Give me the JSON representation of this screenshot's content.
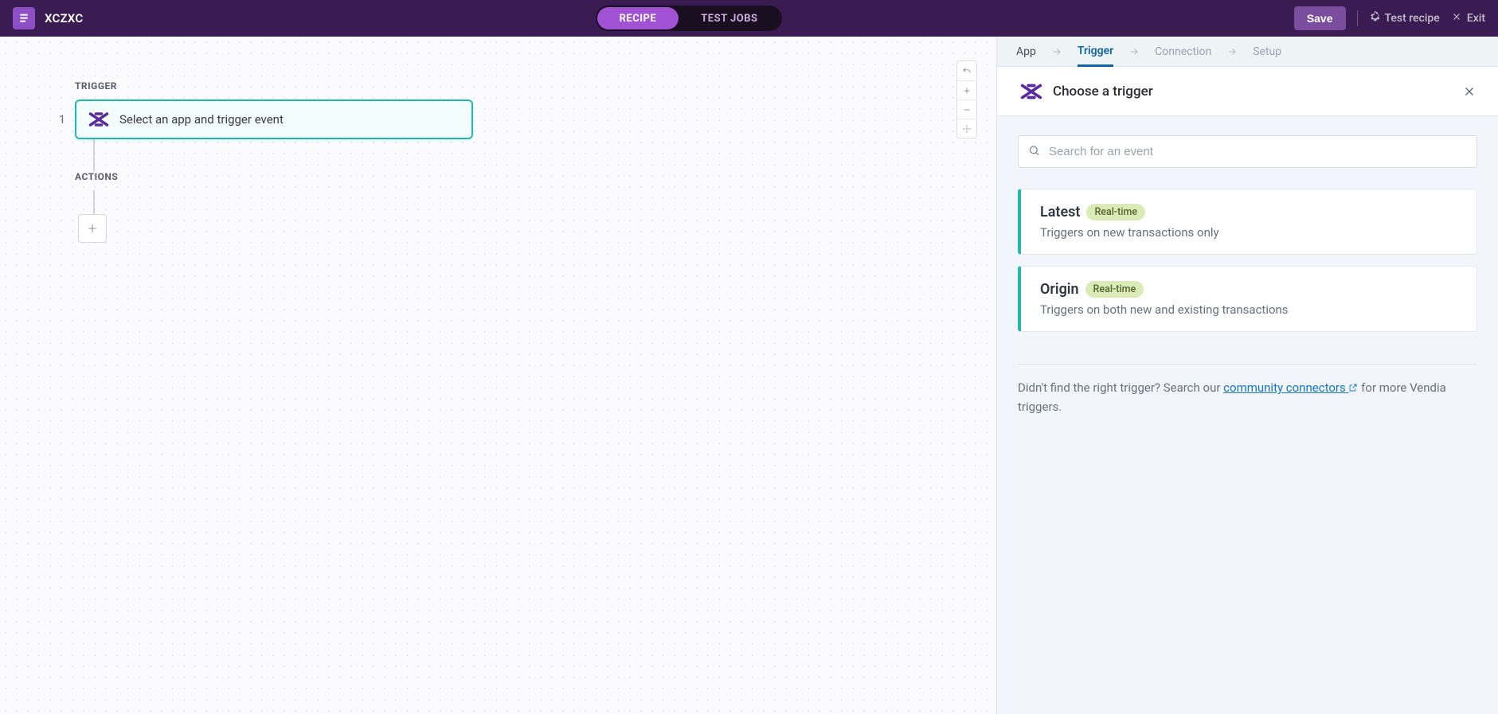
{
  "header": {
    "recipe_name": "XCZXC",
    "pills": {
      "recipe": "RECIPE",
      "test_jobs": "TEST JOBS"
    },
    "save_label": "Save",
    "test_recipe_label": "Test recipe",
    "exit_label": "Exit"
  },
  "canvas": {
    "trigger_section": "TRIGGER",
    "actions_section": "ACTIONS",
    "step1_number": "1",
    "step1_text": "Select an app and trigger event"
  },
  "panel": {
    "tabs": {
      "app": "App",
      "trigger": "Trigger",
      "connection": "Connection",
      "setup": "Setup"
    },
    "title": "Choose a trigger",
    "search_placeholder": "Search for an event",
    "triggers": [
      {
        "name": "Latest",
        "badge": "Real-time",
        "desc": "Triggers on new transactions only"
      },
      {
        "name": "Origin",
        "badge": "Real-time",
        "desc": "Triggers on both new and existing transactions"
      }
    ],
    "hint_prefix": "Didn't find the right trigger? Search our ",
    "hint_link": "community connectors",
    "hint_suffix": " for more Vendia triggers."
  }
}
